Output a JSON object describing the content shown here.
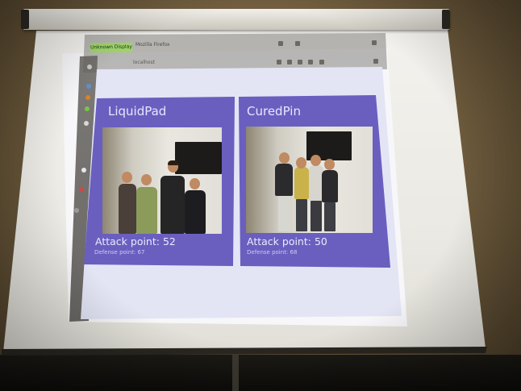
{
  "browser": {
    "title_badge": "Unknown Display",
    "window_title": "Mozilla Firefox",
    "url": "localhost"
  },
  "cards": [
    {
      "name": "LiquidPad",
      "attack_label": "Attack point: 52",
      "defense_label": "Defense point: 67"
    },
    {
      "name": "CuredPin",
      "attack_label": "Attack point: 50",
      "defense_label": "Defense point: 68"
    }
  ],
  "colors": {
    "card_purple": "#6a5fbf",
    "page_background": "#e3e5f5",
    "title_badge_green": "#9fd36b"
  },
  "icons": [
    "sidebar-launcher-icons",
    "toolbar-icons"
  ]
}
